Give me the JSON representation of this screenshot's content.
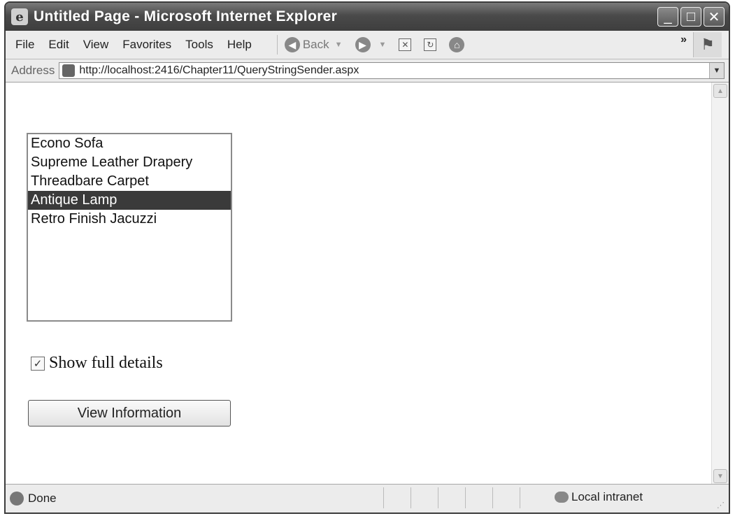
{
  "window": {
    "title": "Untitled Page - Microsoft Internet Explorer",
    "controls": [
      "_",
      "□",
      "✕"
    ]
  },
  "menubar": {
    "items": [
      "File",
      "Edit",
      "View",
      "Favorites",
      "Tools",
      "Help"
    ],
    "back_label": "Back",
    "chevrons": "»"
  },
  "address": {
    "label": "Address",
    "url": "http://localhost:2416/Chapter11/QueryStringSender.aspx"
  },
  "listbox": {
    "items": [
      "Econo Sofa",
      "Supreme Leather Drapery",
      "Threadbare Carpet",
      "Antique Lamp",
      "Retro Finish Jacuzzi"
    ],
    "selected": "Antique Lamp"
  },
  "checkbox": {
    "label": "Show full details",
    "checked": true
  },
  "button": {
    "label": "View Information"
  },
  "statusbar": {
    "status": "Done",
    "zone": "Local intranet"
  },
  "colors": {
    "selection": "#3a3a3a",
    "titlebar": "#4a4a4a"
  }
}
